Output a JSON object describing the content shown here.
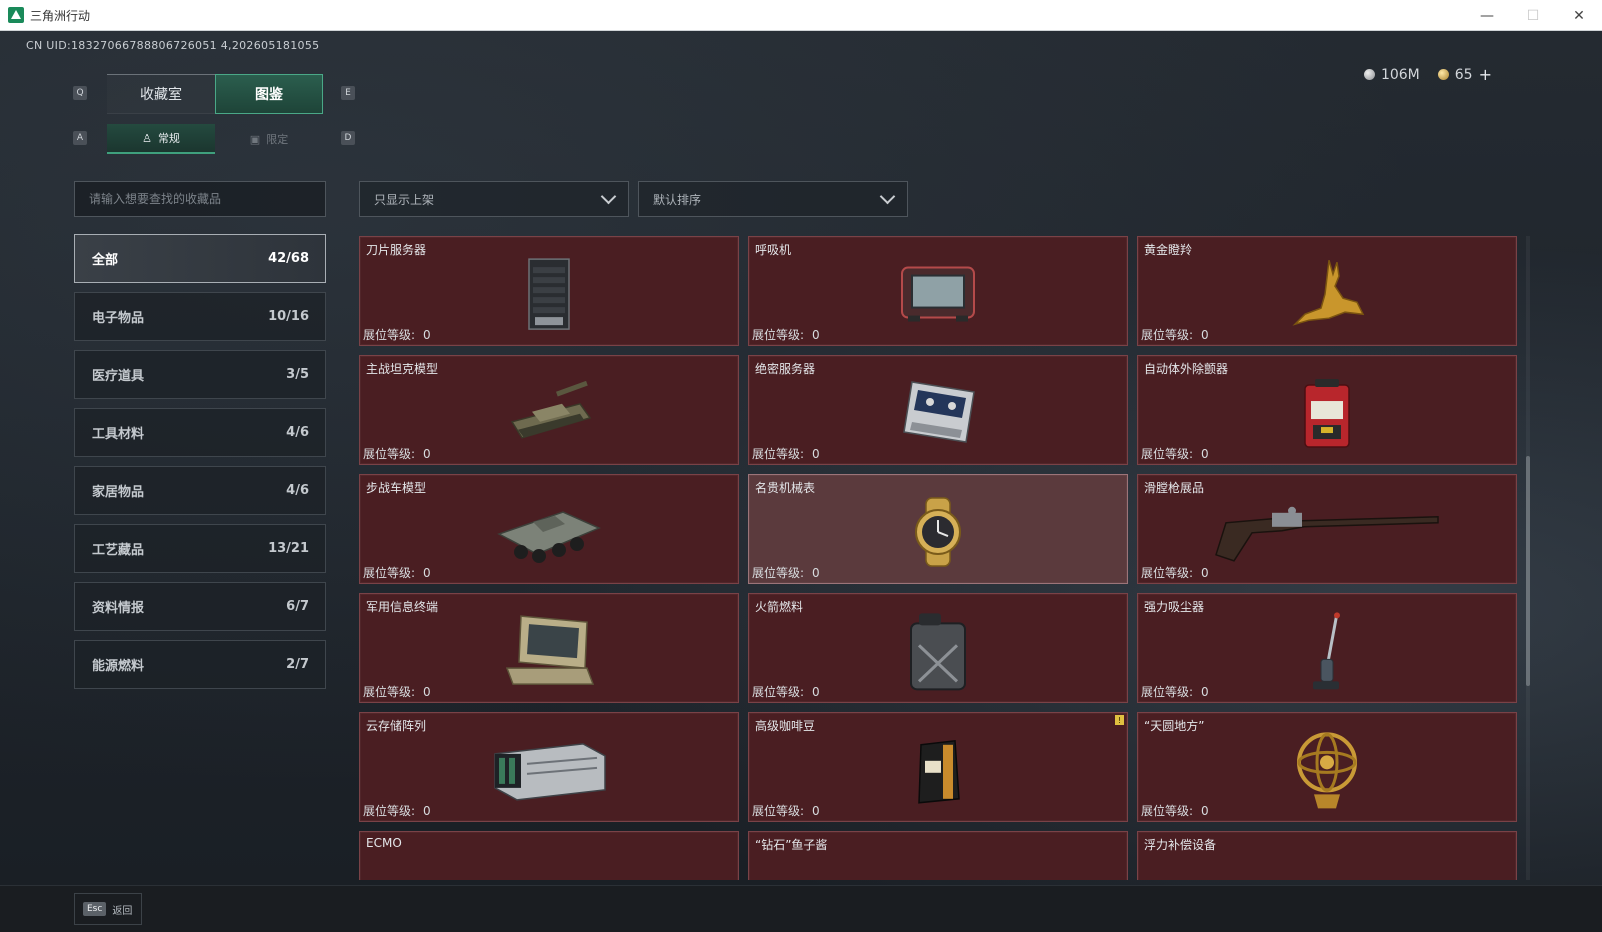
{
  "window": {
    "title": "三角洲行动",
    "controls": [
      "—",
      "☐",
      "✕"
    ]
  },
  "uid": "CN UID:18327066788806726051 4,202605181055",
  "currency": {
    "silver": "106M",
    "gold": "65",
    "add": "+"
  },
  "keys": {
    "q": "Q",
    "e": "E",
    "a": "A",
    "d": "D"
  },
  "main_tabs": [
    {
      "label": "收藏室",
      "active": false
    },
    {
      "label": "图鉴",
      "active": true
    }
  ],
  "sub_tabs": [
    {
      "label": "常规",
      "icon": "♙",
      "active": true
    },
    {
      "label": "限定",
      "icon": "▣",
      "active": false
    }
  ],
  "search": {
    "placeholder": "请输入想要查找的收藏品"
  },
  "filters": {
    "shelf": "只显示上架",
    "sort": "默认排序"
  },
  "categories": [
    {
      "label": "全部",
      "count": "42/68",
      "active": true
    },
    {
      "label": "电子物品",
      "count": "10/16"
    },
    {
      "label": "医疗道具",
      "count": "3/5"
    },
    {
      "label": "工具材料",
      "count": "4/6"
    },
    {
      "label": "家居物品",
      "count": "4/6"
    },
    {
      "label": "工艺藏品",
      "count": "13/21"
    },
    {
      "label": "资料情报",
      "count": "6/7"
    },
    {
      "label": "能源燃料",
      "count": "2/7"
    }
  ],
  "level_label": "展位等级:",
  "items": [
    {
      "name": "刀片服务器",
      "level": "0",
      "icon": "server-icon"
    },
    {
      "name": "呼吸机",
      "level": "0",
      "icon": "ventilator-icon"
    },
    {
      "name": "黄金瞪羚",
      "level": "0",
      "icon": "golden-gazelle-icon"
    },
    {
      "name": "主战坦克模型",
      "level": "0",
      "icon": "tank-model-icon"
    },
    {
      "name": "绝密服务器",
      "level": "0",
      "icon": "secret-server-icon"
    },
    {
      "name": "自动体外除颤器",
      "level": "0",
      "icon": "defibrillator-icon"
    },
    {
      "name": "步战车模型",
      "level": "0",
      "icon": "ifv-model-icon"
    },
    {
      "name": "名贵机械表",
      "level": "0",
      "icon": "watch-icon",
      "highlight": true
    },
    {
      "name": "滑膛枪展品",
      "level": "0",
      "icon": "musket-icon"
    },
    {
      "name": "军用信息终端",
      "level": "0",
      "icon": "terminal-icon"
    },
    {
      "name": "火箭燃料",
      "level": "0",
      "icon": "fuel-can-icon"
    },
    {
      "name": "强力吸尘器",
      "level": "0",
      "icon": "vacuum-icon"
    },
    {
      "name": "云存储阵列",
      "level": "0",
      "icon": "storage-array-icon"
    },
    {
      "name": "高级咖啡豆",
      "level": "0",
      "icon": "coffee-bag-icon",
      "badge": "!"
    },
    {
      "name": "“天圆地方”",
      "level": "0",
      "icon": "armillary-icon"
    },
    {
      "name": "ECMO",
      "level": "",
      "icon": ""
    },
    {
      "name": "“钻石”鱼子酱",
      "level": "",
      "icon": ""
    },
    {
      "name": "浮力补偿设备",
      "level": "",
      "icon": ""
    }
  ],
  "bottom": {
    "esc_key": "Esc",
    "esc_label": "返回"
  }
}
